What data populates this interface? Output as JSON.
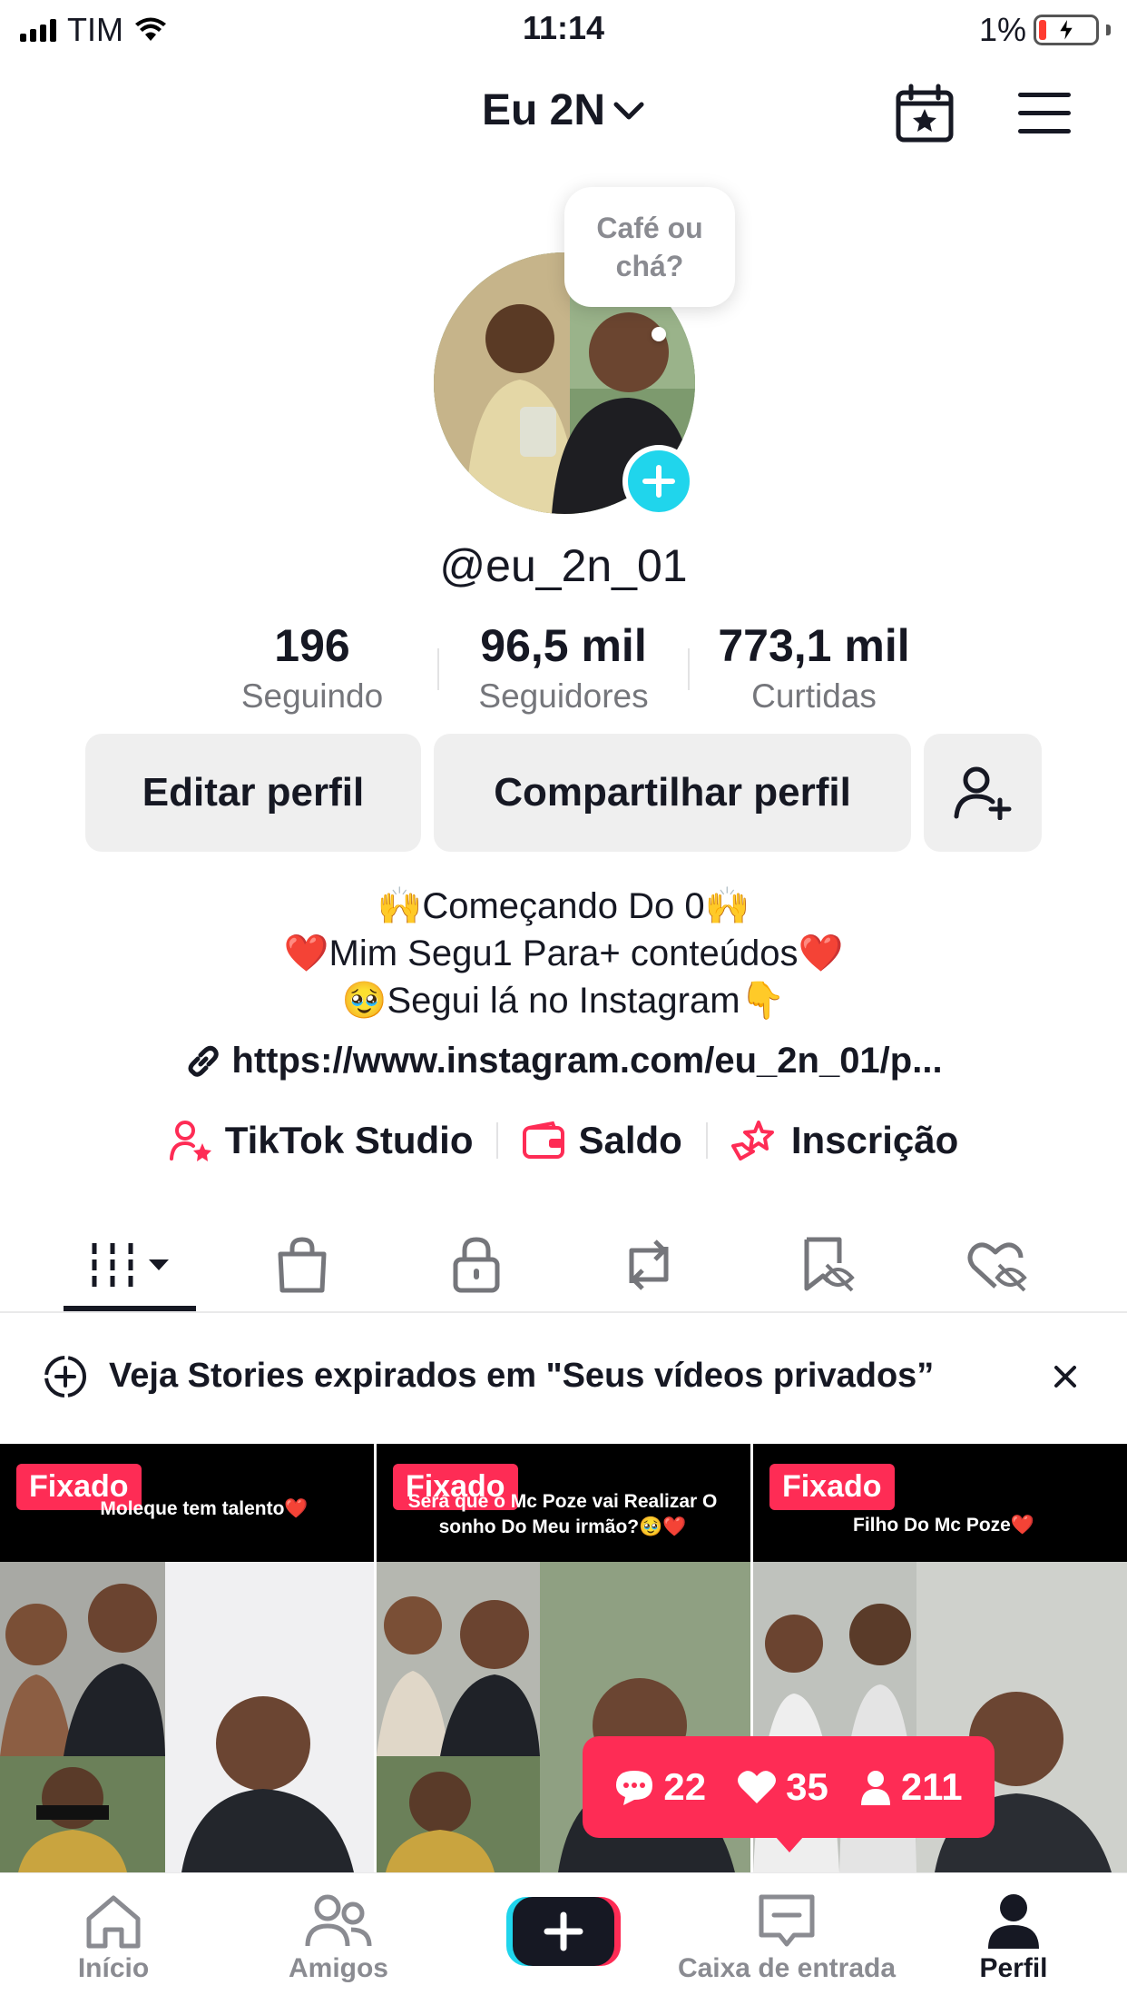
{
  "status_bar": {
    "carrier": "TIM",
    "time": "11:14",
    "battery": "1%"
  },
  "header": {
    "account_name": "Eu 2N"
  },
  "profile": {
    "note": "Café ou chá?",
    "username": "@eu_2n_01"
  },
  "stats": [
    {
      "value": "196",
      "label": "Seguindo"
    },
    {
      "value": "96,5 mil",
      "label": "Seguidores"
    },
    {
      "value": "773,1 mil",
      "label": "Curtidas"
    }
  ],
  "buttons": {
    "edit": "Editar perfil",
    "share": "Compartilhar perfil"
  },
  "bio": {
    "line1_emoji": "🙌",
    "line1": "Começando Do 0",
    "line2_emoji": "❤️",
    "line2": "Mim Segu1 Para+ conteúdos",
    "line3_emoji_start": "🥹",
    "line3": "Segui lá no Instagram",
    "line3_emoji_end": "👇",
    "link": "https://www.instagram.com/eu_2n_01/p..."
  },
  "tools": [
    {
      "label": "TikTok Studio",
      "icon": "person-star-icon"
    },
    {
      "label": "Saldo",
      "icon": "wallet-icon"
    },
    {
      "label": "Inscrição",
      "icon": "star-hand-icon"
    }
  ],
  "tabs": [
    "videos-grid-icon",
    "shop-bag-icon",
    "lock-icon",
    "repost-icon",
    "bookmark-hidden-icon",
    "liked-hidden-icon"
  ],
  "banner": {
    "text": "Veja Stories expirados em \"Seus vídeos privados”"
  },
  "videos": [
    {
      "badge": "Fixado",
      "caption": "Moleque tem talento❤️"
    },
    {
      "badge": "Fixado",
      "caption": "Será que o Mc Poze vai Realizar O sonho Do Meu irmão?🥹❤️"
    },
    {
      "badge": "Fixado",
      "caption": "Filho Do Mc Poze❤️"
    }
  ],
  "popup": {
    "comments": "22",
    "likes": "35",
    "views": "211"
  },
  "nav": [
    {
      "label": "Início",
      "icon": "home-icon"
    },
    {
      "label": "Amigos",
      "icon": "friends-icon"
    },
    {
      "label": "",
      "icon": "create-icon"
    },
    {
      "label": "Caixa de entrada",
      "icon": "inbox-icon"
    },
    {
      "label": "Perfil",
      "icon": "profile-icon"
    }
  ],
  "colors": {
    "accent": "#fe2c55",
    "cyan": "#20d5ec",
    "text": "#161823",
    "muted": "#75767b"
  }
}
